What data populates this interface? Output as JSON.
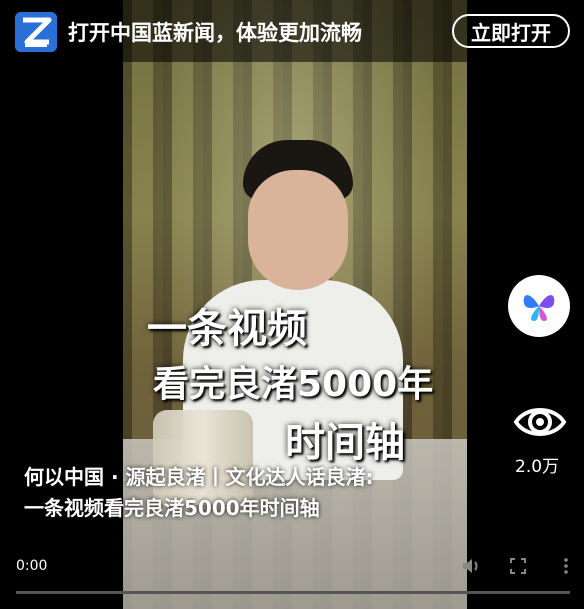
{
  "banner": {
    "logo_icon": "zhejiang-blue-news-logo",
    "text": "打开中国蓝新闻，体验更加流畅",
    "open_button": "立即打开"
  },
  "video": {
    "overlay_lines": [
      "一条视频",
      "看完良渚5000年",
      "时间轴"
    ],
    "caption_line1": "何以中国 · 源起良渚丨文化达人话良渚:",
    "caption_line2": "一条视频看完良渚5000年时间轴"
  },
  "side": {
    "butterfly_icon": "butterfly-app-icon",
    "eye_icon": "eye-icon",
    "views": "2.0万"
  },
  "controls": {
    "current_time": "0:00",
    "progress": 0,
    "icons": [
      "volume-icon",
      "fullscreen-icon",
      "more-icon"
    ]
  },
  "colors": {
    "logo_blue": "#2a6fd6",
    "butterfly_blue": "#2f7cf6",
    "butterfly_purple": "#7b4df0",
    "butterfly_pink": "#d25ad8"
  }
}
